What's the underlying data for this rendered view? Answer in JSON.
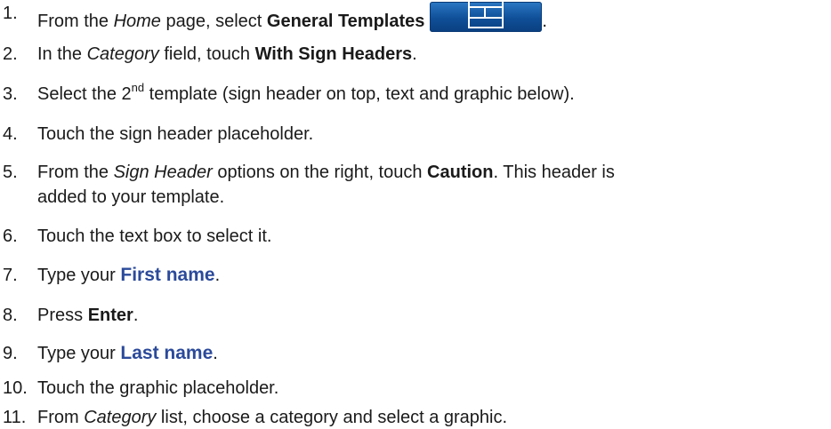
{
  "steps": [
    {
      "num": "1.",
      "a": "From the ",
      "b": "Home",
      "c": " page, select ",
      "d": "General Templates",
      "e": "."
    },
    {
      "num": "2.",
      "a": "In the ",
      "b": "Category",
      "c": " field, touch ",
      "d": "With Sign Headers",
      "e": "."
    },
    {
      "num": "3.",
      "a": "Select the 2",
      "sup": "nd",
      "c": " template (sign header on top, text and graphic below)."
    },
    {
      "num": "4.",
      "a": "Touch the sign header placeholder."
    },
    {
      "num": "5.",
      "a": "From the ",
      "b": "Sign Header",
      "c": " options on the right, touch ",
      "d": "Caution",
      "e": ". This header is",
      "line2": "added to your template."
    },
    {
      "num": "6.",
      "a": "Touch the text box to select it."
    },
    {
      "num": "7.",
      "a": "Type your ",
      "d": "First name",
      "e": "."
    },
    {
      "num": "8.",
      "a": "Press ",
      "d": "Enter",
      "e": "."
    },
    {
      "num": "9.",
      "a": "Type your ",
      "d": "Last name",
      "e": "."
    },
    {
      "num": "10.",
      "a": "Touch the graphic placeholder."
    },
    {
      "num": "11.",
      "a": "From ",
      "b": "Category",
      "c": " list, choose a category and select a graphic."
    }
  ],
  "icons": {
    "general_templates": "template-layout-icon"
  },
  "colors": {
    "emphasis_blue": "#2b4a9a",
    "button_blue": "#1560b0"
  }
}
